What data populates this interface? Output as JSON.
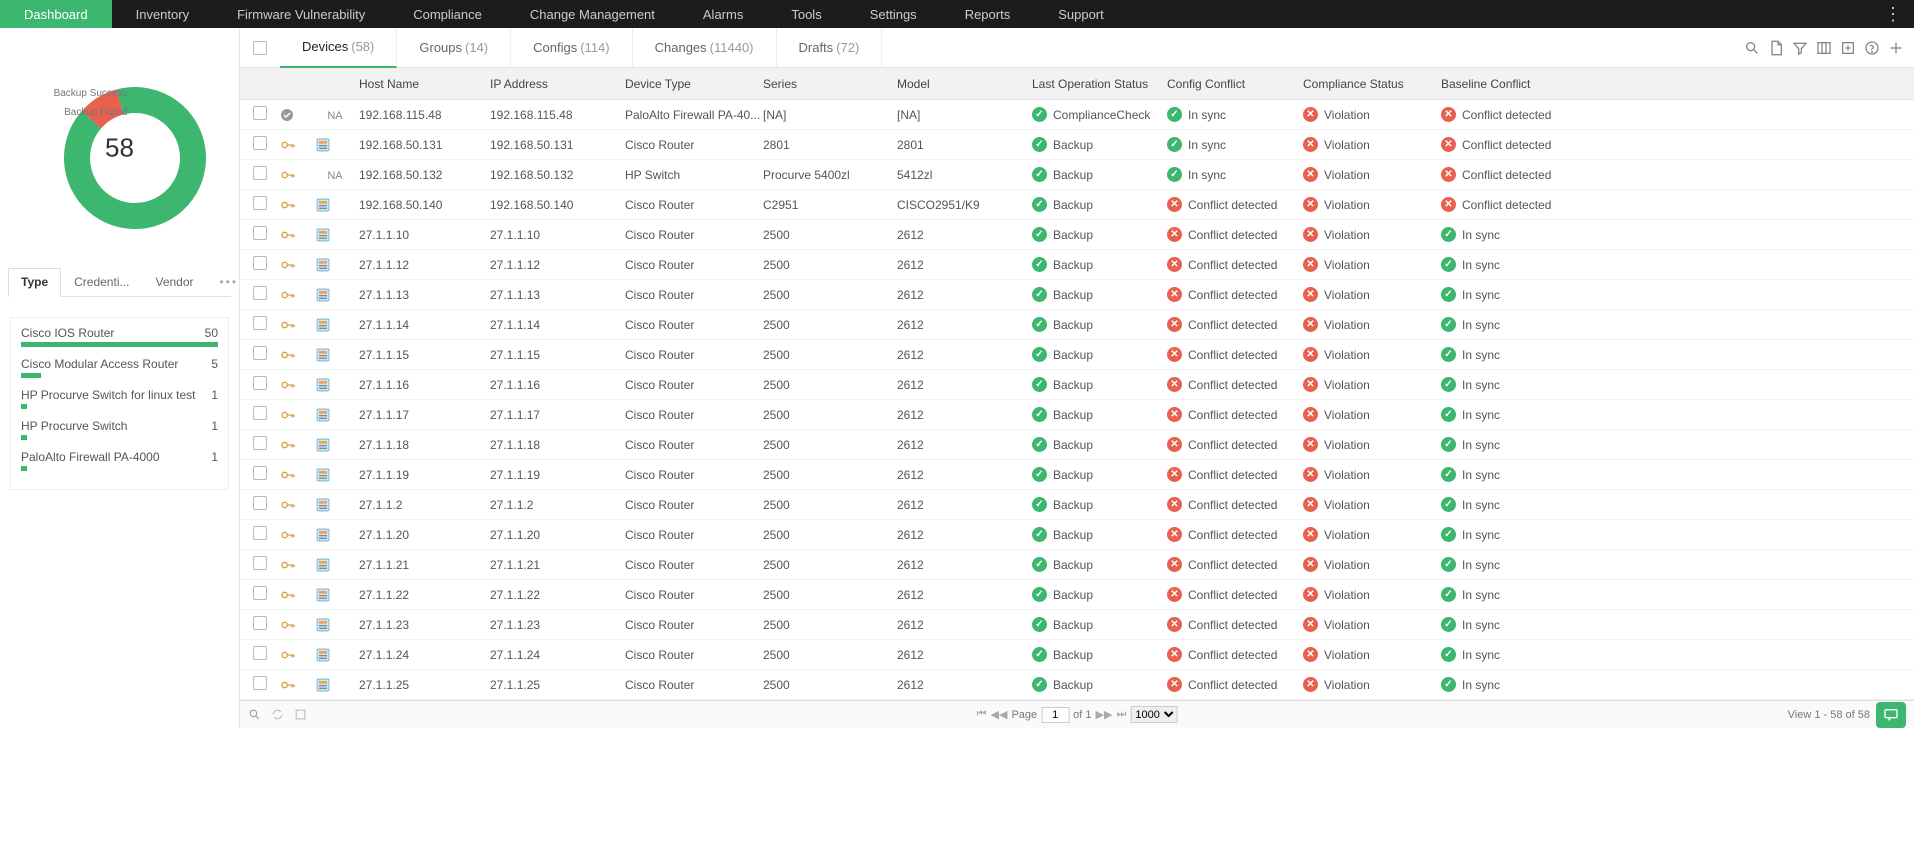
{
  "topnav": [
    "Dashboard",
    "Inventory",
    "Firmware Vulnerability",
    "Compliance",
    "Change Management",
    "Alarms",
    "Tools",
    "Settings",
    "Reports",
    "Support"
  ],
  "topnav_active": 0,
  "donut": {
    "total": "58",
    "legend_success": "Backup Success",
    "legend_failed": "Backup Failed"
  },
  "side_tabs": [
    "Type",
    "Credenti...",
    "Vendor"
  ],
  "side_tabs_active": 0,
  "type_list": [
    {
      "name": "Cisco IOS Router",
      "count": "50",
      "pct": 100
    },
    {
      "name": "Cisco Modular Access Router",
      "count": "5",
      "pct": 10
    },
    {
      "name": "HP Procurve Switch for linux test",
      "count": "1",
      "pct": 3
    },
    {
      "name": "HP Procurve Switch",
      "count": "1",
      "pct": 3
    },
    {
      "name": "PaloAlto Firewall PA-4000",
      "count": "1",
      "pct": 3
    }
  ],
  "subtabs": [
    {
      "label": "Devices",
      "count": "(58)",
      "active": true
    },
    {
      "label": "Groups",
      "count": "(14)"
    },
    {
      "label": "Configs",
      "count": "(114)"
    },
    {
      "label": "Changes",
      "count": "(11440)"
    },
    {
      "label": "Drafts",
      "count": "(72)"
    }
  ],
  "columns": [
    "Host Name",
    "IP Address",
    "Device Type",
    "Series",
    "Model",
    "Last Operation Status",
    "Config Conflict",
    "Compliance Status",
    "Baseline Conflict"
  ],
  "rows": [
    {
      "cred": "na_gray",
      "dev": "NA",
      "host": "192.168.115.48",
      "ip": "192.168.115.48",
      "type": "PaloAlto Firewall PA-40...",
      "series": "[NA]",
      "model": "[NA]",
      "lastop": {
        "s": "ok",
        "t": "ComplianceCheck"
      },
      "conf": {
        "s": "ok",
        "t": "In sync"
      },
      "comp": {
        "s": "bad",
        "t": "Violation"
      },
      "base": {
        "s": "bad",
        "t": "Conflict detected"
      }
    },
    {
      "cred": "key",
      "dev": "dev",
      "host": "192.168.50.131",
      "ip": "192.168.50.131",
      "type": "Cisco Router",
      "series": "2801",
      "model": "2801",
      "lastop": {
        "s": "ok",
        "t": "Backup"
      },
      "conf": {
        "s": "ok",
        "t": "In sync"
      },
      "comp": {
        "s": "bad",
        "t": "Violation"
      },
      "base": {
        "s": "bad",
        "t": "Conflict detected"
      }
    },
    {
      "cred": "key",
      "dev": "NA",
      "host": "192.168.50.132",
      "ip": "192.168.50.132",
      "type": "HP Switch",
      "series": "Procurve 5400zl",
      "model": "5412zl",
      "lastop": {
        "s": "ok",
        "t": "Backup"
      },
      "conf": {
        "s": "ok",
        "t": "In sync"
      },
      "comp": {
        "s": "bad",
        "t": "Violation"
      },
      "base": {
        "s": "bad",
        "t": "Conflict detected"
      }
    },
    {
      "cred": "key",
      "dev": "dev",
      "host": "192.168.50.140",
      "ip": "192.168.50.140",
      "type": "Cisco Router",
      "series": "C2951",
      "model": "CISCO2951/K9",
      "lastop": {
        "s": "ok",
        "t": "Backup"
      },
      "conf": {
        "s": "bad",
        "t": "Conflict detected"
      },
      "comp": {
        "s": "bad",
        "t": "Violation"
      },
      "base": {
        "s": "bad",
        "t": "Conflict detected"
      }
    },
    {
      "cred": "key",
      "dev": "dev",
      "host": "27.1.1.10",
      "ip": "27.1.1.10",
      "type": "Cisco Router",
      "series": "2500",
      "model": "2612",
      "lastop": {
        "s": "ok",
        "t": "Backup"
      },
      "conf": {
        "s": "bad",
        "t": "Conflict detected"
      },
      "comp": {
        "s": "bad",
        "t": "Violation"
      },
      "base": {
        "s": "ok",
        "t": "In sync"
      }
    },
    {
      "cred": "key",
      "dev": "dev",
      "host": "27.1.1.12",
      "ip": "27.1.1.12",
      "type": "Cisco Router",
      "series": "2500",
      "model": "2612",
      "lastop": {
        "s": "ok",
        "t": "Backup"
      },
      "conf": {
        "s": "bad",
        "t": "Conflict detected"
      },
      "comp": {
        "s": "bad",
        "t": "Violation"
      },
      "base": {
        "s": "ok",
        "t": "In sync"
      }
    },
    {
      "cred": "key",
      "dev": "dev",
      "host": "27.1.1.13",
      "ip": "27.1.1.13",
      "type": "Cisco Router",
      "series": "2500",
      "model": "2612",
      "lastop": {
        "s": "ok",
        "t": "Backup"
      },
      "conf": {
        "s": "bad",
        "t": "Conflict detected"
      },
      "comp": {
        "s": "bad",
        "t": "Violation"
      },
      "base": {
        "s": "ok",
        "t": "In sync"
      }
    },
    {
      "cred": "key",
      "dev": "dev",
      "host": "27.1.1.14",
      "ip": "27.1.1.14",
      "type": "Cisco Router",
      "series": "2500",
      "model": "2612",
      "lastop": {
        "s": "ok",
        "t": "Backup"
      },
      "conf": {
        "s": "bad",
        "t": "Conflict detected"
      },
      "comp": {
        "s": "bad",
        "t": "Violation"
      },
      "base": {
        "s": "ok",
        "t": "In sync"
      }
    },
    {
      "cred": "key",
      "dev": "dev",
      "host": "27.1.1.15",
      "ip": "27.1.1.15",
      "type": "Cisco Router",
      "series": "2500",
      "model": "2612",
      "lastop": {
        "s": "ok",
        "t": "Backup"
      },
      "conf": {
        "s": "bad",
        "t": "Conflict detected"
      },
      "comp": {
        "s": "bad",
        "t": "Violation"
      },
      "base": {
        "s": "ok",
        "t": "In sync"
      }
    },
    {
      "cred": "key",
      "dev": "dev",
      "host": "27.1.1.16",
      "ip": "27.1.1.16",
      "type": "Cisco Router",
      "series": "2500",
      "model": "2612",
      "lastop": {
        "s": "ok",
        "t": "Backup"
      },
      "conf": {
        "s": "bad",
        "t": "Conflict detected"
      },
      "comp": {
        "s": "bad",
        "t": "Violation"
      },
      "base": {
        "s": "ok",
        "t": "In sync"
      }
    },
    {
      "cred": "key",
      "dev": "dev",
      "host": "27.1.1.17",
      "ip": "27.1.1.17",
      "type": "Cisco Router",
      "series": "2500",
      "model": "2612",
      "lastop": {
        "s": "ok",
        "t": "Backup"
      },
      "conf": {
        "s": "bad",
        "t": "Conflict detected"
      },
      "comp": {
        "s": "bad",
        "t": "Violation"
      },
      "base": {
        "s": "ok",
        "t": "In sync"
      }
    },
    {
      "cred": "key",
      "dev": "dev",
      "host": "27.1.1.18",
      "ip": "27.1.1.18",
      "type": "Cisco Router",
      "series": "2500",
      "model": "2612",
      "lastop": {
        "s": "ok",
        "t": "Backup"
      },
      "conf": {
        "s": "bad",
        "t": "Conflict detected"
      },
      "comp": {
        "s": "bad",
        "t": "Violation"
      },
      "base": {
        "s": "ok",
        "t": "In sync"
      }
    },
    {
      "cred": "key",
      "dev": "dev",
      "host": "27.1.1.19",
      "ip": "27.1.1.19",
      "type": "Cisco Router",
      "series": "2500",
      "model": "2612",
      "lastop": {
        "s": "ok",
        "t": "Backup"
      },
      "conf": {
        "s": "bad",
        "t": "Conflict detected"
      },
      "comp": {
        "s": "bad",
        "t": "Violation"
      },
      "base": {
        "s": "ok",
        "t": "In sync"
      }
    },
    {
      "cred": "key",
      "dev": "dev",
      "host": "27.1.1.2",
      "ip": "27.1.1.2",
      "type": "Cisco Router",
      "series": "2500",
      "model": "2612",
      "lastop": {
        "s": "ok",
        "t": "Backup"
      },
      "conf": {
        "s": "bad",
        "t": "Conflict detected"
      },
      "comp": {
        "s": "bad",
        "t": "Violation"
      },
      "base": {
        "s": "ok",
        "t": "In sync"
      }
    },
    {
      "cred": "key",
      "dev": "dev",
      "host": "27.1.1.20",
      "ip": "27.1.1.20",
      "type": "Cisco Router",
      "series": "2500",
      "model": "2612",
      "lastop": {
        "s": "ok",
        "t": "Backup"
      },
      "conf": {
        "s": "bad",
        "t": "Conflict detected"
      },
      "comp": {
        "s": "bad",
        "t": "Violation"
      },
      "base": {
        "s": "ok",
        "t": "In sync"
      }
    },
    {
      "cred": "key",
      "dev": "dev",
      "host": "27.1.1.21",
      "ip": "27.1.1.21",
      "type": "Cisco Router",
      "series": "2500",
      "model": "2612",
      "lastop": {
        "s": "ok",
        "t": "Backup"
      },
      "conf": {
        "s": "bad",
        "t": "Conflict detected"
      },
      "comp": {
        "s": "bad",
        "t": "Violation"
      },
      "base": {
        "s": "ok",
        "t": "In sync"
      }
    },
    {
      "cred": "key",
      "dev": "dev",
      "host": "27.1.1.22",
      "ip": "27.1.1.22",
      "type": "Cisco Router",
      "series": "2500",
      "model": "2612",
      "lastop": {
        "s": "ok",
        "t": "Backup"
      },
      "conf": {
        "s": "bad",
        "t": "Conflict detected"
      },
      "comp": {
        "s": "bad",
        "t": "Violation"
      },
      "base": {
        "s": "ok",
        "t": "In sync"
      }
    },
    {
      "cred": "key",
      "dev": "dev",
      "host": "27.1.1.23",
      "ip": "27.1.1.23",
      "type": "Cisco Router",
      "series": "2500",
      "model": "2612",
      "lastop": {
        "s": "ok",
        "t": "Backup"
      },
      "conf": {
        "s": "bad",
        "t": "Conflict detected"
      },
      "comp": {
        "s": "bad",
        "t": "Violation"
      },
      "base": {
        "s": "ok",
        "t": "In sync"
      }
    },
    {
      "cred": "key",
      "dev": "dev",
      "host": "27.1.1.24",
      "ip": "27.1.1.24",
      "type": "Cisco Router",
      "series": "2500",
      "model": "2612",
      "lastop": {
        "s": "ok",
        "t": "Backup"
      },
      "conf": {
        "s": "bad",
        "t": "Conflict detected"
      },
      "comp": {
        "s": "bad",
        "t": "Violation"
      },
      "base": {
        "s": "ok",
        "t": "In sync"
      }
    },
    {
      "cred": "key",
      "dev": "dev",
      "host": "27.1.1.25",
      "ip": "27.1.1.25",
      "type": "Cisco Router",
      "series": "2500",
      "model": "2612",
      "lastop": {
        "s": "ok",
        "t": "Backup"
      },
      "conf": {
        "s": "bad",
        "t": "Conflict detected"
      },
      "comp": {
        "s": "bad",
        "t": "Violation"
      },
      "base": {
        "s": "ok",
        "t": "In sync"
      }
    }
  ],
  "footer": {
    "page_label": "Page",
    "page_value": "1",
    "of_label": "of 1",
    "page_size": "1000",
    "view_text": "View 1 - 58 of 58"
  }
}
